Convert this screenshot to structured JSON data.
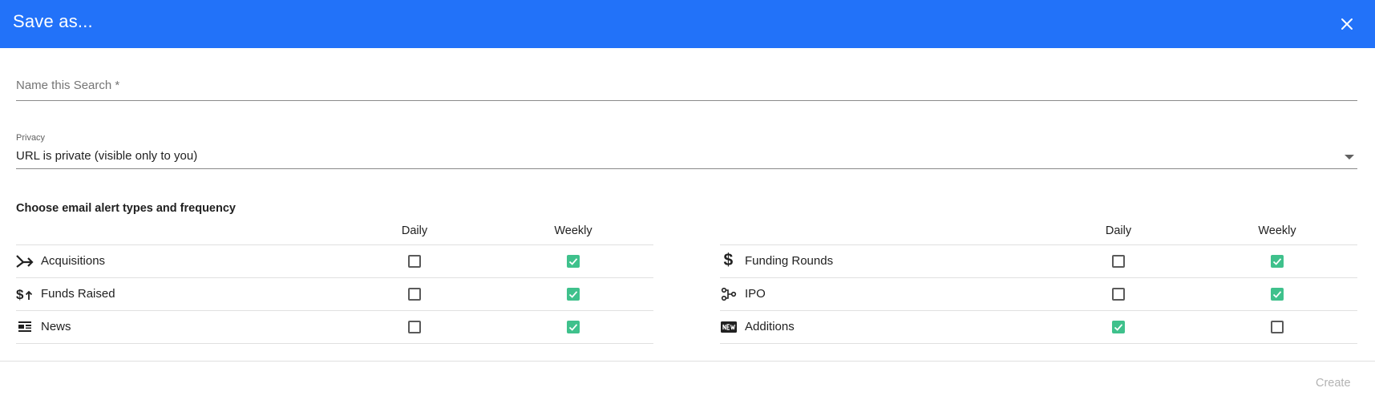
{
  "dialog": {
    "title": "Save as...",
    "close_icon": "close-icon",
    "accent_color": "#2272f9"
  },
  "name_field": {
    "placeholder": "Name this Search *",
    "value": ""
  },
  "privacy": {
    "label": "Privacy",
    "value": "URL is private (visible only to you)",
    "icon": "dropdown-arrow-icon"
  },
  "alerts": {
    "title": "Choose email alert types and frequency",
    "checked_color": "#3fc18c",
    "columns": [
      "Daily",
      "Weekly"
    ],
    "left": [
      {
        "label": "Acquisitions",
        "icon": "acquisitions-icon",
        "daily": false,
        "weekly": true
      },
      {
        "label": "Funds Raised",
        "icon": "funds-raised-icon",
        "daily": false,
        "weekly": true
      },
      {
        "label": "News",
        "icon": "news-icon",
        "daily": false,
        "weekly": true
      }
    ],
    "right": [
      {
        "label": "Funding Rounds",
        "icon": "dollar-icon",
        "daily": false,
        "weekly": true
      },
      {
        "label": "IPO",
        "icon": "ipo-icon",
        "daily": false,
        "weekly": true
      },
      {
        "label": "Additions",
        "icon": "new-badge-icon",
        "daily": true,
        "weekly": false
      }
    ]
  },
  "footer": {
    "create_label": "Create"
  }
}
